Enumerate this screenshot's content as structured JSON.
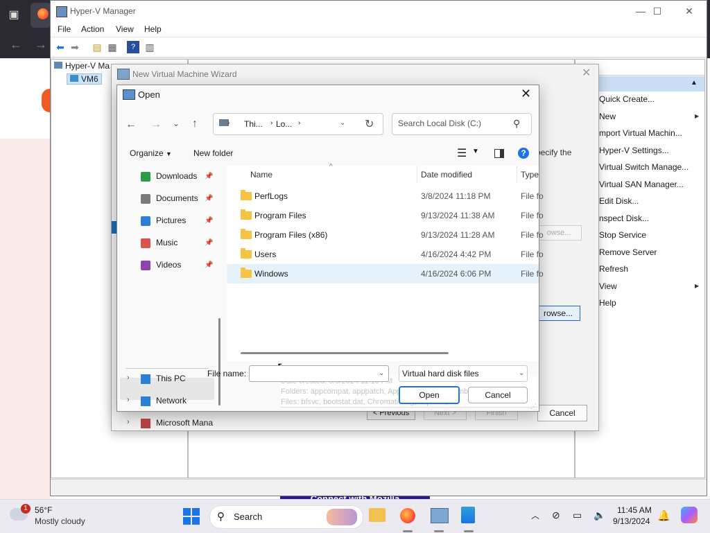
{
  "hyperv": {
    "title": "Hyper-V Manager",
    "menu": [
      "File",
      "Action",
      "View",
      "Help"
    ],
    "tree_root": "Hyper-V Ma",
    "tree_vm": "VM6",
    "actions_header": "ns",
    "actions": [
      {
        "label": "Quick Create...",
        "submenu": false
      },
      {
        "label": "New",
        "submenu": true
      },
      {
        "label": "mport Virtual Machin...",
        "submenu": false
      },
      {
        "label": "Hyper-V Settings...",
        "submenu": false
      },
      {
        "label": "Virtual Switch Manage...",
        "submenu": false
      },
      {
        "label": "Virtual SAN Manager...",
        "submenu": false
      },
      {
        "label": "Edit Disk...",
        "submenu": false
      },
      {
        "label": "nspect Disk...",
        "submenu": false
      },
      {
        "label": "Stop Service",
        "submenu": false
      },
      {
        "label": "Remove Server",
        "submenu": false
      },
      {
        "label": "Refresh",
        "submenu": false
      },
      {
        "label": "View",
        "submenu": true
      },
      {
        "label": "Help",
        "submenu": false
      }
    ]
  },
  "wizard": {
    "title": "New Virtual Machine Wizard",
    "specify_text": "pecify the",
    "browse_disabled": "owse...",
    "browse_label": "rowse...",
    "prev_label": "< Previous",
    "next_label": "Next >",
    "finish_label": "Finish",
    "cancel_label": "Cancel"
  },
  "open_dialog": {
    "title": "Open",
    "breadcrumb": [
      "Thi...",
      "Lo..."
    ],
    "search_placeholder": "Search Local Disk (C:)",
    "organize_label": "Organize",
    "new_folder_label": "New folder",
    "nav_items": [
      {
        "label": "Downloads",
        "icon": "download-icon",
        "pinned": true
      },
      {
        "label": "Documents",
        "icon": "documents-icon",
        "pinned": true
      },
      {
        "label": "Pictures",
        "icon": "pictures-icon",
        "pinned": true
      },
      {
        "label": "Music",
        "icon": "music-icon",
        "pinned": true
      },
      {
        "label": "Videos",
        "icon": "videos-icon",
        "pinned": true
      }
    ],
    "nav_locations": [
      "This PC",
      "Network",
      "Microsoft Mana"
    ],
    "columns": {
      "name": "Name",
      "date": "Date modified",
      "type": "Type"
    },
    "files": [
      {
        "name": "PerfLogs",
        "date": "3/8/2024 11:18 PM",
        "type": "File fo"
      },
      {
        "name": "Program Files",
        "date": "9/13/2024 11:38 AM",
        "type": "File fo"
      },
      {
        "name": "Program Files (x86)",
        "date": "9/13/2024 11:28 AM",
        "type": "File fo"
      },
      {
        "name": "Users",
        "date": "4/16/2024 4:42 PM",
        "type": "File fo"
      },
      {
        "name": "Windows",
        "date": "4/16/2024 6:06 PM",
        "type": "File fo"
      }
    ],
    "tooltip_lines": [
      "Date created: 3/8/2024 11:18 PM",
      "Folders: appcompat, apppatch, AppReadiness, assembly, bcastdvr, ...",
      "Files: bfsvc, bootstat.dat, Chromatic.log, explorer, ..."
    ],
    "file_name_label": "File name:",
    "file_name_value": "",
    "file_type": "Virtual hard disk files",
    "open_label": "Open",
    "cancel_label": "Cancel"
  },
  "browser": {
    "banner_text": "Connect with Mozilla"
  },
  "taskbar": {
    "weather_temp": "56°F",
    "weather_desc": "Mostly cloudy",
    "weather_badge": "1",
    "search_label": "Search",
    "time": "11:45 AM",
    "date": "9/13/2024"
  }
}
